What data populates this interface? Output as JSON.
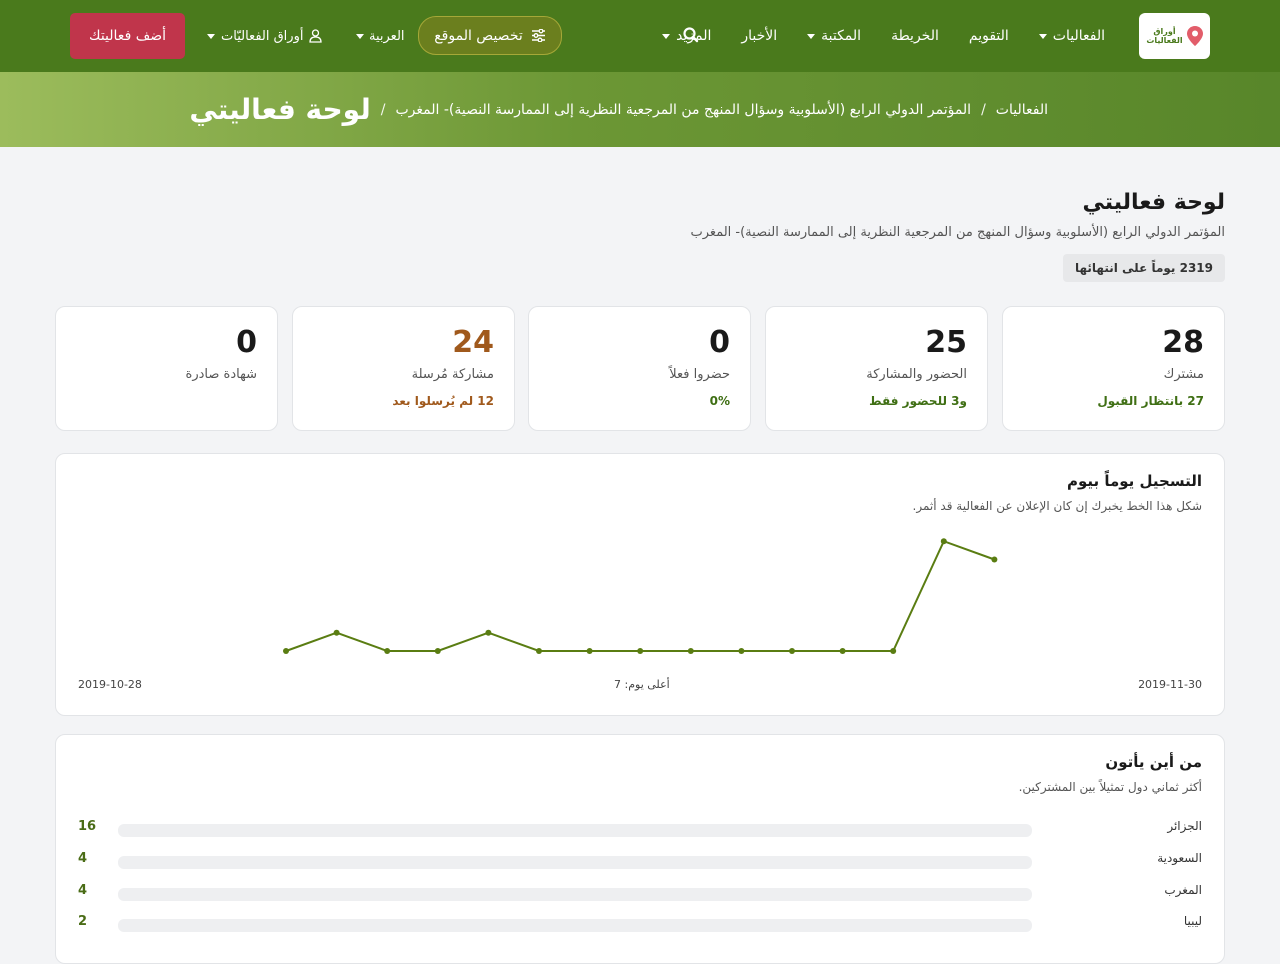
{
  "nav": {
    "logo_text_1": "أوراق",
    "logo_text_2": "الفعاليات",
    "items": [
      {
        "label": "الفعاليات",
        "dropdown": true
      },
      {
        "label": "التقويم",
        "dropdown": false
      },
      {
        "label": "الخريطة",
        "dropdown": false
      },
      {
        "label": "المكتبة",
        "dropdown": true
      },
      {
        "label": "الأخبار",
        "dropdown": false
      },
      {
        "label": "المزيد",
        "dropdown": true
      }
    ],
    "customize_label": "تخصيص الموقع",
    "language_label": "العربية",
    "account_label": "أوراق الفعاليّات",
    "add_event_label": "أضف فعاليتك"
  },
  "breadcrumb": {
    "home": "الفعاليات",
    "event": "المؤتمر الدولي الرابع (الأسلوبية وسؤال المنهج من المرجعية النظرية إلى الممارسة النصية)- المغرب",
    "separator": "/",
    "current": "لوحة فعاليتي"
  },
  "header": {
    "title": "لوحة فعاليتي",
    "subtitle": "المؤتمر الدولي الرابع (الأسلوبية وسؤال المنهج من المرجعية النظرية إلى الممارسة النصية)- المغرب",
    "days_badge": "2319 يوماً على انتهائها"
  },
  "stats": [
    {
      "value": "28",
      "label": "مشترك",
      "sub": "27 بانتظار القبول",
      "accent": "green"
    },
    {
      "value": "25",
      "label": "الحضور والمشاركة",
      "sub": "و3 للحضور فقط",
      "accent": "green"
    },
    {
      "value": "0",
      "label": "حضروا فعلاً",
      "sub": "0%",
      "accent": "green"
    },
    {
      "value": "24",
      "label": "مشاركة مُرسلة",
      "sub": "12 لم يُرسلوا بعد",
      "accent": "orange"
    },
    {
      "value": "0",
      "label": "شهادة صادرة",
      "sub": "",
      "accent": "none"
    }
  ],
  "registration_chart": {
    "title": "التسجيل يوماً بيوم",
    "subtitle": "شكل هذا الخط يخبرك إن كان الإعلان عن الفعالية قد أثمر.",
    "start_date": "2019-10-28",
    "end_date": "2019-11-30",
    "peak_label": "أعلى يوم: 7",
    "line_color": "#5a7d12"
  },
  "chart_data": {
    "type": "line",
    "x_range": [
      "2019-10-28",
      "2019-11-30"
    ],
    "values": [
      0,
      1,
      0,
      0,
      1,
      0,
      0,
      0,
      0,
      0,
      0,
      0,
      0,
      6,
      5
    ],
    "ymax": 7,
    "grid": false
  },
  "countries": {
    "title": "من أين يأتون",
    "subtitle": "أكثر ثماني دول تمثيلاً بين المشتركين.",
    "rows": [
      {
        "name": "الجزائر",
        "count": "16"
      },
      {
        "name": "السعودية",
        "count": "4"
      },
      {
        "name": "المغرب",
        "count": "4"
      },
      {
        "name": "ليبيا",
        "count": "2"
      }
    ]
  },
  "colors": {
    "navbar": "#4a7a1c",
    "add_button": "#c0354b",
    "accent_green": "#3f6f14",
    "accent_orange": "#a0591c"
  }
}
